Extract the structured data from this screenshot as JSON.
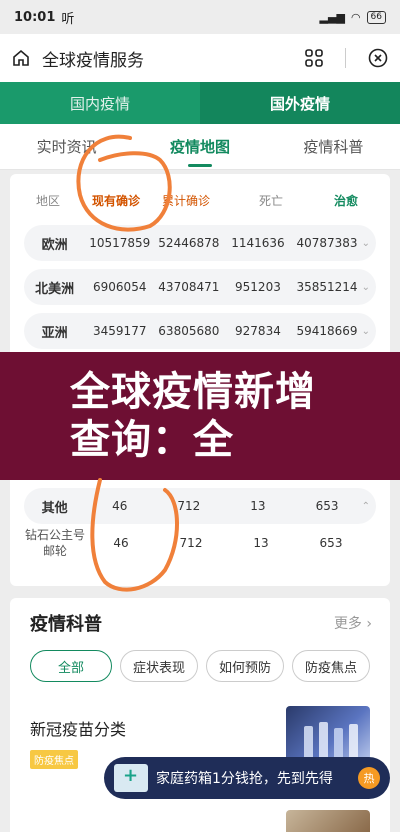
{
  "statusbar": {
    "time": "10:01",
    "indicator": "听",
    "network": "4G",
    "battery": "66"
  },
  "navbar": {
    "title": "全球疫情服务"
  },
  "top_tabs": [
    {
      "label": "国内疫情"
    },
    {
      "label": "国外疫情"
    }
  ],
  "sub_tabs": [
    {
      "label": "实时资讯"
    },
    {
      "label": "疫情地图"
    },
    {
      "label": "疫情科普"
    }
  ],
  "table": {
    "headers": [
      "地区",
      "现有确诊",
      "累计确诊",
      "死亡",
      "治愈"
    ],
    "rows": [
      {
        "region": "欧洲",
        "current": "10517859",
        "total": "52446878",
        "deaths": "1141636",
        "cured": "40787383"
      },
      {
        "region": "北美洲",
        "current": "6906054",
        "total": "43708471",
        "deaths": "951203",
        "cured": "35851214"
      },
      {
        "region": "亚洲",
        "current": "3459177",
        "total": "63805680",
        "deaths": "927834",
        "cured": "59418669"
      },
      {
        "region": "其他",
        "current": "46",
        "total": "712",
        "deaths": "13",
        "cured": "653"
      },
      {
        "region": "钻石公主号邮轮",
        "current": "46",
        "total": "712",
        "deaths": "13",
        "cured": "653"
      }
    ]
  },
  "overlay_banner": {
    "text": "全球疫情新增查询：全"
  },
  "science": {
    "title": "疫情科普",
    "more": "更多",
    "chips": [
      "全部",
      "症状表现",
      "如何预防",
      "防疫焦点"
    ],
    "article": {
      "title": "新冠疫苗分类",
      "tag": "防疫焦点"
    }
  },
  "promo": {
    "text": "家庭药箱1分钱抢，先到先得",
    "badge": "热"
  },
  "colors": {
    "brand_green": "#1a9a6b",
    "accent_orange": "#d35400",
    "banner": "#6e0f33"
  }
}
